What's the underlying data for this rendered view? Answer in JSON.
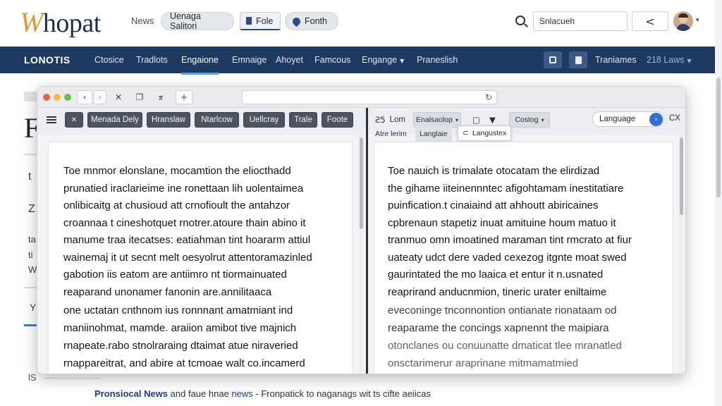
{
  "site": {
    "logo_mark": "W",
    "logo_text": "hopat",
    "nav_news": "News",
    "pill_1": "Uenaga Salitori",
    "pill_2": "Fole",
    "pill_3": "Fonth",
    "search_value": "Snlacueh",
    "back_label": "<"
  },
  "navbar": {
    "brand": "LONOTIS",
    "items": [
      "Ctosice",
      "Tradlots",
      "Engaione",
      "Emnaige",
      "Ahoyet",
      "Famcous",
      "Engange",
      "Praneslish"
    ],
    "right_link_1": "Traniames",
    "right_link_2": "218 Laws"
  },
  "background": {
    "big_letter": "F",
    "frag_1": "t",
    "frag_2": "Z",
    "frag_3": "ta",
    "frag_4": "ti",
    "frag_5": "W",
    "frag_6": "Y",
    "bottom_left": "lS",
    "bottom_bold": "Pronsiocal News",
    "bottom_mid": " and faue hnae ",
    "bottom_link": "news",
    "bottom_rest": " - Fronpatick to naganags wit ts cifte aeiicas"
  },
  "browser": {
    "back": "‹",
    "forward": "›",
    "stop": "✕",
    "copy": "❐",
    "pin": "⌆",
    "new_tab": "+",
    "reload": "↻"
  },
  "left_pane": {
    "toolbar": [
      "Menada Dely",
      "Hranslaw",
      "Ntarlcow",
      "Uellcray",
      "Trale",
      "Foote"
    ],
    "toolbar_icon": "✕",
    "lines": [
      "Toe mnmor elonslane, mocamtion the eliocthadd",
      "prunatied iraclarieime ine ronettaan lih uolentaimea",
      "onlibicaitg at chusioud att crnofioult the antahzor",
      "croannaa t cineshotquet rnotrer.atoure thain abino it",
      "manume traa itecatses: eatiahman tint hoararm attiul",
      "wainemaj it ut secnt melt oesyolrut attentoramazinled",
      "gabotion iis eatom are antiimro nt tiormainuated",
      "reaparand unonamer fanonin are.annilitaaca",
      "one uctatan cnthnom ius ronnnant amatmiant ind",
      "maniinohmat, mamde. araiion amibot tive majnich",
      "rnapeate.rabo stnolraraing dtaimat atue niraveried",
      "rnappareitrat, and abire at tcmoae walt co.incamerd"
    ]
  },
  "right_pane": {
    "tool_1": "Lom",
    "tool_1_icon": "Ƨ5",
    "tool_2": "Enalsaolop",
    "tool_4": "Costog",
    "sub_1": "Atre lerim",
    "sub_2": "Langlaie",
    "dropdown_item": "Langustex",
    "dropdown_icon": "⊂",
    "language_label": "Language",
    "cx_label": "CX",
    "lines": [
      "Toe nauich is trimalate otocatam the elirdizad",
      "the gihame iiteinennntec afigohtamam inestitatiare",
      "puinfication.t cinaiaind att ahhoutt abiricaines",
      "cpbrenaun stapetiz inuat amituine houm matuo it",
      "tranmuo omn imoatined maraman tint rmcrato at fiur",
      "uateaty udct dere vaded cexezog itgnte moat swed",
      "gaurintated the mo laaica et entur it n.usnated",
      "reaprirand anducnmion, tineric urater eniltaime",
      "eveconinge tnconnontion ontianate rionataam od",
      "reaparame the concings xapnennt the maipiara",
      "otonclanes ou conuunatte dmaticat tlee mranatled",
      "onsctarimerur araprinane mitmamatmied"
    ]
  },
  "colors": {
    "navbar": "#1f3a62",
    "accent": "#2f6fd6",
    "divider": "#2c2f35"
  }
}
